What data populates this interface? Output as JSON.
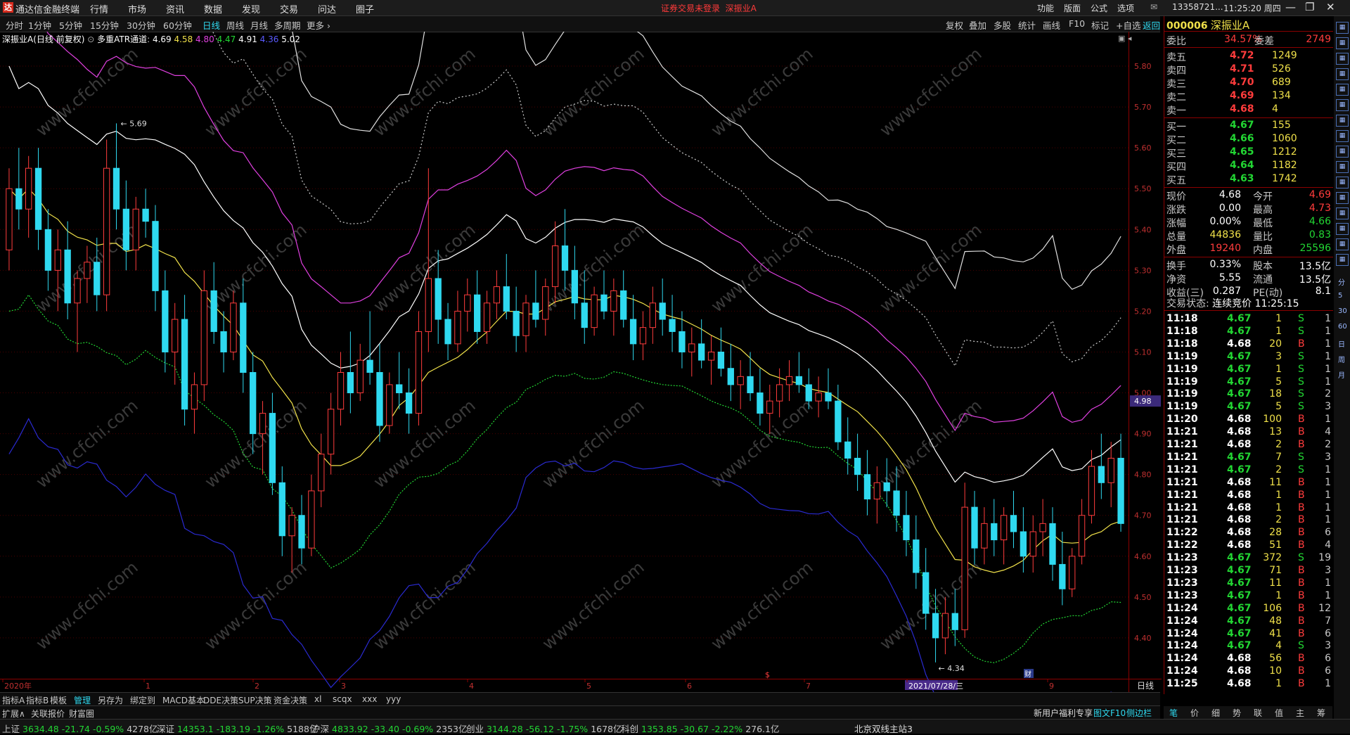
{
  "app": {
    "logo": "达",
    "title": "通达信金融终端",
    "menu": [
      "行情",
      "市场",
      "资讯",
      "数据",
      "发现",
      "交易",
      "问达",
      "圈子"
    ],
    "notice": "证券交易未登录",
    "notice_stock": "深振业A",
    "toolbar_right": [
      "功能",
      "版面",
      "公式",
      "选项"
    ],
    "account": "13358721...",
    "clock": "11:25:20 周四"
  },
  "periods": {
    "items": [
      "分时",
      "1分钟",
      "5分钟",
      "15分钟",
      "30分钟",
      "60分钟",
      "日线",
      "周线",
      "月线",
      "多周期",
      "更多"
    ],
    "active": "日线"
  },
  "chart_tools": [
    "复权",
    "叠加",
    "多股",
    "统计",
    "画线",
    "F10",
    "标记",
    "+自选",
    "返回"
  ],
  "indicator": {
    "stock": "深振业A",
    "mode": "(日线 前复权)",
    "name": "多重ATR通道",
    "values": [
      "4.69",
      "4.58",
      "4.80",
      "4.47",
      "4.91",
      "4.36",
      "5.02"
    ],
    "colors": [
      "#ffffff",
      "#f0e14a",
      "#e040e0",
      "#22d633",
      "#ffffff",
      "#4a4aff",
      "#ffffff"
    ]
  },
  "chart": {
    "price_labels": [
      "5.80",
      "5.70",
      "5.60",
      "5.50",
      "5.40",
      "5.30",
      "5.20",
      "5.10",
      "5.00",
      "4.90",
      "4.80",
      "4.70",
      "4.60",
      "4.50",
      "4.40"
    ],
    "current_price_tag": "4.98",
    "high_mark": "5.69",
    "low_mark": "4.34",
    "x_labels": [
      "2020年",
      "1",
      "2",
      "3",
      "4",
      "5",
      "6",
      "7",
      "2021/07/28/三",
      "9"
    ],
    "events": [
      "$",
      "财"
    ],
    "period_label": "日线",
    "watermark": "www.cfchi.com"
  },
  "chart_data": {
    "type": "candlestick",
    "ylim": [
      4.3,
      5.85
    ],
    "ohlc": [
      [
        5.35,
        5.55,
        5.3,
        5.5
      ],
      [
        5.5,
        5.6,
        5.4,
        5.45
      ],
      [
        5.45,
        5.58,
        5.38,
        5.55
      ],
      [
        5.55,
        5.6,
        5.35,
        5.4
      ],
      [
        5.4,
        5.45,
        5.25,
        5.3
      ],
      [
        5.3,
        5.4,
        5.2,
        5.35
      ],
      [
        5.35,
        5.42,
        5.18,
        5.22
      ],
      [
        5.22,
        5.3,
        5.1,
        5.28
      ],
      [
        5.28,
        5.36,
        5.22,
        5.32
      ],
      [
        5.32,
        5.38,
        5.2,
        5.24
      ],
      [
        5.24,
        5.62,
        5.2,
        5.55
      ],
      [
        5.55,
        5.66,
        5.4,
        5.45
      ],
      [
        5.45,
        5.52,
        5.3,
        5.35
      ],
      [
        5.35,
        5.48,
        5.3,
        5.45
      ],
      [
        5.45,
        5.5,
        5.38,
        5.42
      ],
      [
        5.42,
        5.46,
        5.2,
        5.25
      ],
      [
        5.25,
        5.3,
        5.05,
        5.1
      ],
      [
        5.1,
        5.22,
        5.02,
        5.18
      ],
      [
        5.18,
        5.24,
        4.92,
        4.96
      ],
      [
        4.96,
        5.05,
        4.9,
        5.02
      ],
      [
        5.02,
        5.3,
        4.98,
        5.25
      ],
      [
        5.25,
        5.32,
        5.12,
        5.15
      ],
      [
        5.15,
        5.2,
        5.05,
        5.1
      ],
      [
        5.1,
        5.25,
        5.08,
        5.22
      ],
      [
        5.22,
        5.28,
        5.0,
        5.05
      ],
      [
        5.05,
        5.1,
        4.85,
        4.9
      ],
      [
        4.9,
        4.98,
        4.8,
        4.95
      ],
      [
        4.95,
        5.0,
        4.75,
        4.78
      ],
      [
        4.78,
        4.82,
        4.6,
        4.65
      ],
      [
        4.65,
        4.72,
        4.56,
        4.7
      ],
      [
        4.7,
        4.75,
        4.58,
        4.62
      ],
      [
        4.62,
        4.8,
        4.6,
        4.76
      ],
      [
        4.76,
        4.9,
        4.72,
        4.85
      ],
      [
        4.85,
        5.0,
        4.8,
        4.96
      ],
      [
        4.96,
        5.1,
        4.92,
        5.05
      ],
      [
        5.05,
        5.15,
        4.95,
        5.0
      ],
      [
        5.0,
        5.12,
        4.98,
        5.08
      ],
      [
        5.08,
        5.2,
        5.02,
        5.05
      ],
      [
        5.05,
        5.12,
        4.88,
        4.92
      ],
      [
        4.92,
        5.05,
        4.9,
        5.02
      ],
      [
        5.02,
        5.1,
        4.96,
        5.0
      ],
      [
        5.0,
        5.06,
        4.9,
        4.95
      ],
      [
        4.95,
        5.2,
        4.92,
        5.15
      ],
      [
        5.15,
        5.55,
        5.1,
        5.28
      ],
      [
        5.28,
        5.35,
        5.12,
        5.18
      ],
      [
        5.18,
        5.22,
        5.08,
        5.12
      ],
      [
        5.12,
        5.25,
        5.1,
        5.2
      ],
      [
        5.2,
        5.28,
        5.15,
        5.24
      ],
      [
        5.24,
        5.3,
        5.12,
        5.15
      ],
      [
        5.15,
        5.25,
        5.12,
        5.22
      ],
      [
        5.22,
        5.3,
        5.18,
        5.26
      ],
      [
        5.26,
        5.34,
        5.18,
        5.2
      ],
      [
        5.2,
        5.26,
        5.1,
        5.14
      ],
      [
        5.14,
        5.24,
        5.1,
        5.22
      ],
      [
        5.22,
        5.3,
        5.16,
        5.18
      ],
      [
        5.18,
        5.28,
        5.14,
        5.26
      ],
      [
        5.26,
        5.42,
        5.22,
        5.36
      ],
      [
        5.36,
        5.45,
        5.25,
        5.3
      ],
      [
        5.3,
        5.36,
        5.18,
        5.22
      ],
      [
        5.22,
        5.3,
        5.12,
        5.16
      ],
      [
        5.16,
        5.26,
        5.14,
        5.24
      ],
      [
        5.24,
        5.3,
        5.18,
        5.2
      ],
      [
        5.2,
        5.28,
        5.14,
        5.25
      ],
      [
        5.25,
        5.3,
        5.16,
        5.18
      ],
      [
        5.18,
        5.24,
        5.08,
        5.12
      ],
      [
        5.12,
        5.2,
        5.08,
        5.16
      ],
      [
        5.16,
        5.26,
        5.12,
        5.22
      ],
      [
        5.22,
        5.28,
        5.14,
        5.18
      ],
      [
        5.18,
        5.24,
        5.1,
        5.15
      ],
      [
        5.15,
        5.2,
        5.06,
        5.1
      ],
      [
        5.1,
        5.16,
        5.04,
        5.12
      ],
      [
        5.12,
        5.18,
        5.06,
        5.08
      ],
      [
        5.08,
        5.14,
        5.02,
        5.1
      ],
      [
        5.1,
        5.16,
        5.04,
        5.06
      ],
      [
        5.06,
        5.12,
        4.98,
        5.02
      ],
      [
        5.02,
        5.08,
        4.96,
        5.04
      ],
      [
        5.04,
        5.1,
        4.98,
        5.0
      ],
      [
        5.0,
        5.06,
        4.92,
        4.95
      ],
      [
        4.95,
        5.02,
        4.9,
        4.98
      ],
      [
        4.98,
        5.06,
        4.94,
        5.02
      ],
      [
        5.02,
        5.08,
        4.98,
        5.04
      ],
      [
        5.04,
        5.1,
        5.0,
        5.02
      ],
      [
        5.02,
        5.06,
        4.96,
        4.98
      ],
      [
        4.98,
        5.04,
        4.94,
        5.0
      ],
      [
        5.0,
        5.06,
        4.96,
        4.98
      ],
      [
        4.98,
        5.02,
        4.86,
        4.88
      ],
      [
        4.88,
        4.94,
        4.8,
        4.84
      ],
      [
        4.84,
        4.9,
        4.76,
        4.8
      ],
      [
        4.8,
        4.86,
        4.7,
        4.74
      ],
      [
        4.74,
        4.82,
        4.68,
        4.78
      ],
      [
        4.78,
        4.84,
        4.72,
        4.76
      ],
      [
        4.76,
        4.82,
        4.66,
        4.7
      ],
      [
        4.7,
        4.76,
        4.6,
        4.64
      ],
      [
        4.64,
        4.7,
        4.52,
        4.56
      ],
      [
        4.56,
        4.62,
        4.42,
        4.46
      ],
      [
        4.46,
        4.52,
        4.34,
        4.4
      ],
      [
        4.4,
        4.5,
        4.36,
        4.46
      ],
      [
        4.46,
        4.52,
        4.38,
        4.42
      ],
      [
        4.42,
        4.78,
        4.4,
        4.72
      ],
      [
        4.72,
        4.76,
        4.58,
        4.62
      ],
      [
        4.62,
        4.72,
        4.58,
        4.68
      ],
      [
        4.68,
        4.74,
        4.6,
        4.64
      ],
      [
        4.64,
        4.72,
        4.58,
        4.7
      ],
      [
        4.7,
        4.76,
        4.62,
        4.66
      ],
      [
        4.66,
        4.72,
        4.56,
        4.6
      ],
      [
        4.6,
        4.7,
        4.56,
        4.66
      ],
      [
        4.66,
        4.74,
        4.6,
        4.68
      ],
      [
        4.68,
        4.72,
        4.54,
        4.58
      ],
      [
        4.58,
        4.66,
        4.48,
        4.52
      ],
      [
        4.52,
        4.62,
        4.5,
        4.6
      ],
      [
        4.6,
        4.74,
        4.58,
        4.7
      ],
      [
        4.7,
        4.86,
        4.68,
        4.82
      ],
      [
        4.82,
        4.9,
        4.74,
        4.78
      ],
      [
        4.78,
        4.88,
        4.72,
        4.84
      ],
      [
        4.84,
        4.9,
        4.66,
        4.68
      ]
    ]
  },
  "quote": {
    "code": "000006",
    "name": "深振业A",
    "weibi_label": "委比",
    "weibi": "34.57%",
    "weicha_label": "委差",
    "weicha": "2749",
    "sells": [
      {
        "label": "卖五",
        "price": "4.72",
        "vol": "1249"
      },
      {
        "label": "卖四",
        "price": "4.71",
        "vol": "526"
      },
      {
        "label": "卖三",
        "price": "4.70",
        "vol": "689"
      },
      {
        "label": "卖二",
        "price": "4.69",
        "vol": "134"
      },
      {
        "label": "卖一",
        "price": "4.68",
        "vol": "4"
      }
    ],
    "buys": [
      {
        "label": "买一",
        "price": "4.67",
        "vol": "155"
      },
      {
        "label": "买二",
        "price": "4.66",
        "vol": "1060"
      },
      {
        "label": "买三",
        "price": "4.65",
        "vol": "1212"
      },
      {
        "label": "买四",
        "price": "4.64",
        "vol": "1182"
      },
      {
        "label": "买五",
        "price": "4.63",
        "vol": "1742"
      }
    ],
    "stats": [
      {
        "l1": "现价",
        "v1": "4.68",
        "c1": "white",
        "l2": "今开",
        "v2": "4.69",
        "c2": "red"
      },
      {
        "l1": "涨跌",
        "v1": "0.00",
        "c1": "white",
        "l2": "最高",
        "v2": "4.73",
        "c2": "red"
      },
      {
        "l1": "涨幅",
        "v1": "0.00%",
        "c1": "white",
        "l2": "最低",
        "v2": "4.66",
        "c2": "green"
      },
      {
        "l1": "总量",
        "v1": "44836",
        "c1": "yellow",
        "l2": "量比",
        "v2": "0.83",
        "c2": "green"
      },
      {
        "l1": "外盘",
        "v1": "19240",
        "c1": "red",
        "l2": "内盘",
        "v2": "25596",
        "c2": "green"
      }
    ],
    "stats2": [
      {
        "l1": "换手",
        "v1": "0.33%",
        "l2": "股本",
        "v2": "13.5亿"
      },
      {
        "l1": "净资",
        "v1": "5.55",
        "l2": "流通",
        "v2": "13.5亿"
      },
      {
        "l1": "收益(三)",
        "v1": "0.287",
        "l2": "PE(动)",
        "v2": "8.1"
      }
    ],
    "trade_status_label": "交易状态:",
    "trade_status": "连续竞价",
    "trade_time": "11:25:15"
  },
  "ticks": [
    [
      "11:18",
      "4.67",
      "1",
      "S",
      "1"
    ],
    [
      "11:18",
      "4.67",
      "1",
      "S",
      "1"
    ],
    [
      "11:18",
      "4.68",
      "20",
      "B",
      "1"
    ],
    [
      "11:19",
      "4.67",
      "3",
      "S",
      "1"
    ],
    [
      "11:19",
      "4.67",
      "1",
      "S",
      "1"
    ],
    [
      "11:19",
      "4.67",
      "5",
      "S",
      "1"
    ],
    [
      "11:19",
      "4.67",
      "18",
      "S",
      "2"
    ],
    [
      "11:19",
      "4.67",
      "5",
      "S",
      "3"
    ],
    [
      "11:20",
      "4.68",
      "100",
      "B",
      "1"
    ],
    [
      "11:21",
      "4.68",
      "13",
      "B",
      "4"
    ],
    [
      "11:21",
      "4.68",
      "2",
      "B",
      "2"
    ],
    [
      "11:21",
      "4.67",
      "7",
      "S",
      "3"
    ],
    [
      "11:21",
      "4.67",
      "2",
      "S",
      "1"
    ],
    [
      "11:21",
      "4.68",
      "11",
      "B",
      "1"
    ],
    [
      "11:21",
      "4.68",
      "1",
      "B",
      "1"
    ],
    [
      "11:21",
      "4.68",
      "1",
      "B",
      "1"
    ],
    [
      "11:21",
      "4.68",
      "2",
      "B",
      "1"
    ],
    [
      "11:22",
      "4.68",
      "28",
      "B",
      "6"
    ],
    [
      "11:22",
      "4.68",
      "51",
      "B",
      "4"
    ],
    [
      "11:23",
      "4.67",
      "372",
      "S",
      "19"
    ],
    [
      "11:23",
      "4.67",
      "71",
      "B",
      "3"
    ],
    [
      "11:23",
      "4.67",
      "11",
      "B",
      "1"
    ],
    [
      "11:23",
      "4.67",
      "1",
      "B",
      "1"
    ],
    [
      "11:24",
      "4.67",
      "106",
      "B",
      "12"
    ],
    [
      "11:24",
      "4.67",
      "48",
      "B",
      "7"
    ],
    [
      "11:24",
      "4.67",
      "41",
      "B",
      "6"
    ],
    [
      "11:24",
      "4.67",
      "4",
      "S",
      "3"
    ],
    [
      "11:24",
      "4.68",
      "56",
      "B",
      "6"
    ],
    [
      "11:24",
      "4.68",
      "10",
      "B",
      "6"
    ],
    [
      "11:25",
      "4.68",
      "1",
      "B",
      "1"
    ]
  ],
  "bottom_tabs": {
    "items": [
      "指标A",
      "指标B",
      "模板",
      "管理",
      "另存为",
      "绑定到",
      "MACD基本",
      "DDE决策",
      "SUP决策",
      "资金决策",
      "xl",
      "scqx",
      "xxx",
      "yyy"
    ],
    "active": "管理"
  },
  "bottom_tabs2": [
    "扩展∧",
    "关联报价",
    "财富圈"
  ],
  "right_bottom": {
    "promo": "新用户福利专享",
    "links": [
      "图文F10",
      "侧边栏"
    ],
    "tabs": [
      "笔",
      "价",
      "细",
      "势",
      "联",
      "值",
      "主",
      "筹"
    ]
  },
  "status": {
    "indices": [
      {
        "name": "上证",
        "value": "3634.48",
        "chg": "-21.74",
        "pct": "-0.59%",
        "amt": "4278亿"
      },
      {
        "name": "深证",
        "value": "14353.1",
        "chg": "-183.19",
        "pct": "-1.26%",
        "amt": "5188亿"
      },
      {
        "name": "沪深",
        "value": "4833.92",
        "chg": "-33.40",
        "pct": "-0.69%",
        "amt": "2353亿"
      },
      {
        "name": "创业",
        "value": "3144.28",
        "chg": "-56.12",
        "pct": "-1.75%",
        "amt": "1678亿"
      },
      {
        "name": "科创",
        "value": "1353.85",
        "chg": "-30.67",
        "pct": "-2.22%",
        "amt": "276.1亿"
      }
    ],
    "server": "北京双线主站3"
  }
}
